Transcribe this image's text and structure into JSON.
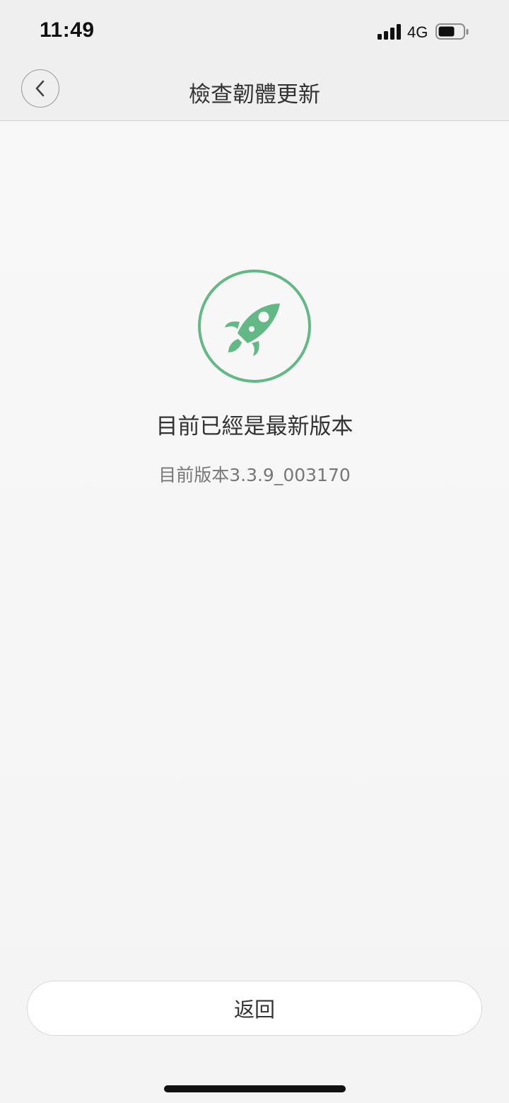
{
  "status_bar": {
    "time": "11:49",
    "network": "4G",
    "icons": [
      "signal-icon",
      "battery-icon"
    ]
  },
  "nav": {
    "title": "檢查韌體更新",
    "back_icon": "chevron-left-icon"
  },
  "main": {
    "icon": "rocket-icon",
    "status_title": "目前已經是最新版本",
    "version_text": "目前版本3.3.9_003170"
  },
  "footer": {
    "return_label": "返回"
  },
  "colors": {
    "accent": "#63b985",
    "background": "#f4f4f4",
    "header": "#efeff0"
  }
}
